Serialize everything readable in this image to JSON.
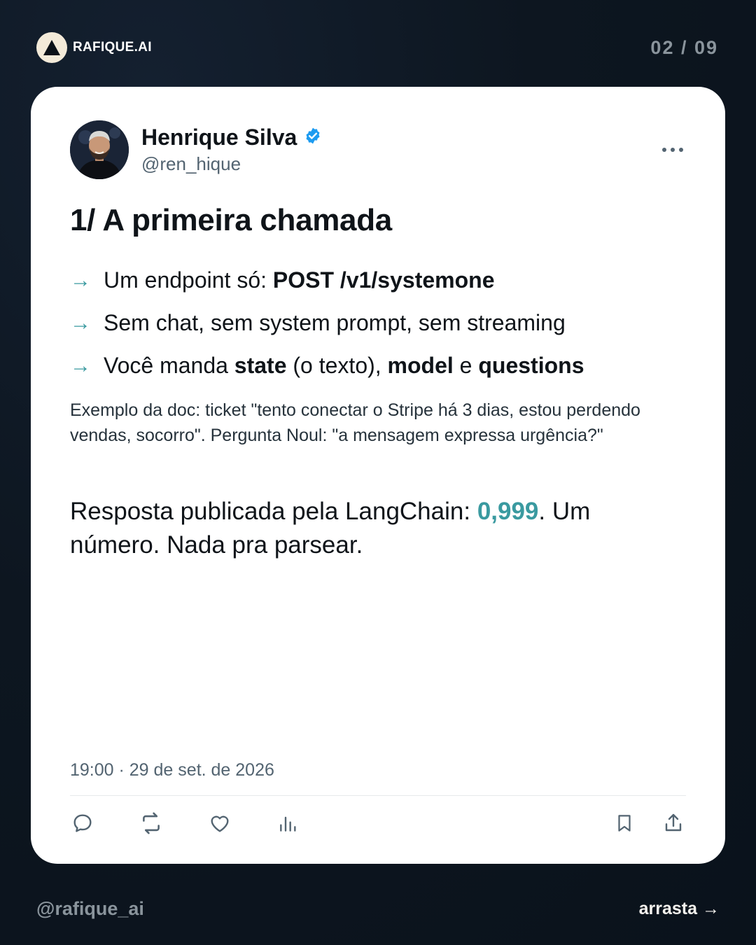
{
  "brand": {
    "name": "RAFIQUE.AI",
    "logo_icon": "triangle-logo-icon"
  },
  "page_counter": "02 / 09",
  "post": {
    "author": {
      "name": "Henrique Silva",
      "handle": "@ren_hique",
      "verified": true,
      "avatar_icon": "avatar-photo"
    },
    "title": "1/ A primeira chamada",
    "bullets": [
      {
        "arrow": "→",
        "text": "Um endpoint só: ",
        "bold": "POST /v1/systemone"
      },
      {
        "arrow": "→",
        "text": "Sem chat, sem system prompt, sem streaming"
      },
      {
        "arrow": "→",
        "prefix": "Você manda ",
        "bold1": "state",
        "mid1": " (o texto), ",
        "bold2": "model",
        "mid2": " e ",
        "bold3": "questions"
      }
    ],
    "example": "Exemplo da doc: ticket \"tento conectar o Stripe há 3 dias, estou perdendo vendas, socorro\". Pergunta Noul: \"a mensagem expressa urgência?\"",
    "answer": {
      "prefix": "Resposta publicada pela LangChain: ",
      "highlight": "0,999",
      "suffix": ". Um número. Nada pra parsear."
    },
    "timestamp": "19:00 · 29 de set. de 2026",
    "actions": [
      "reply-icon",
      "repost-icon",
      "like-icon",
      "views-icon",
      "bookmark-icon",
      "share-icon"
    ]
  },
  "footer": {
    "handle": "@rafique_ai",
    "swipe_hint": "arrasta →"
  },
  "colors": {
    "accent": "#3a9aa0",
    "verified": "#1d9bf0",
    "background": "#0d1620",
    "card": "#ffffff",
    "muted": "#536471"
  }
}
